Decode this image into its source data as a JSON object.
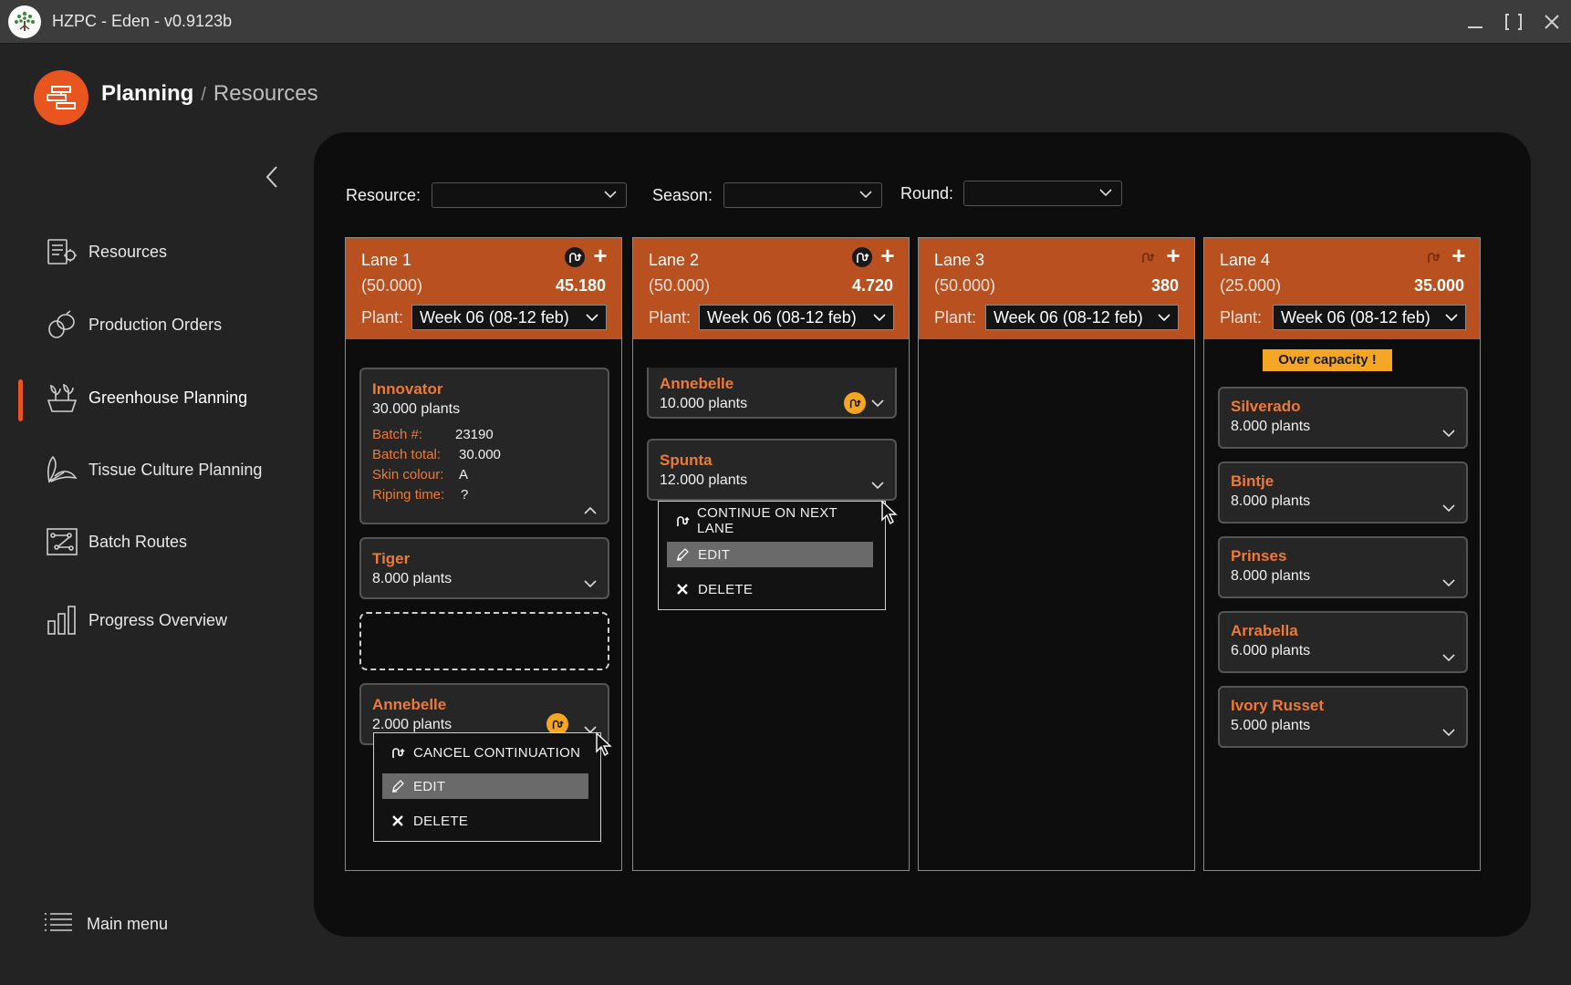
{
  "titlebar": {
    "title": "HZPC - Eden - v0.9123b",
    "icons": [
      "minimize-icon",
      "maximize-icon",
      "close-icon"
    ]
  },
  "header": {
    "current": "Planning",
    "separator": "/",
    "sub": "Resources"
  },
  "sidebar": {
    "items": [
      {
        "label": "Resources",
        "icon": "resources-icon"
      },
      {
        "label": "Production Orders",
        "icon": "production-orders-icon"
      },
      {
        "label": "Greenhouse Planning",
        "icon": "greenhouse-icon",
        "active": true
      },
      {
        "label": "Tissue Culture Planning",
        "icon": "leaf-icon"
      },
      {
        "label": "Batch Routes",
        "icon": "routes-icon"
      },
      {
        "label": "Progress Overview",
        "icon": "bar-chart-icon"
      }
    ],
    "main_menu": "Main menu"
  },
  "filters": {
    "resource": {
      "label": "Resource:",
      "value": ""
    },
    "season": {
      "label": "Season:",
      "value": ""
    },
    "round": {
      "label": "Round:",
      "value": ""
    }
  },
  "lanes": [
    {
      "name": "Lane 1",
      "capacity": "(50.000)",
      "total": "45.180",
      "plant_label": "Plant:",
      "week": "Week 06 (08-12 feb)",
      "cards": [
        {
          "name": "Innovator",
          "plants": "30.000 plants",
          "details": [
            {
              "label": "Batch #:",
              "value": "23190"
            },
            {
              "label": "Batch total:",
              "value": "30.000"
            },
            {
              "label": "Skin colour:",
              "value": "A"
            },
            {
              "label": "Riping time:",
              "value": "?"
            }
          ]
        },
        {
          "name": "Tiger",
          "plants": "8.000 plants"
        },
        {
          "name": "Annebelle",
          "plants": "2.000 plants"
        }
      ],
      "menu": [
        "CANCEL CONTINUATION",
        "EDIT",
        "DELETE"
      ]
    },
    {
      "name": "Lane 2",
      "capacity": "(50.000)",
      "total": "4.720",
      "plant_label": "Plant:",
      "week": "Week 06 (08-12 feb)",
      "cards": [
        {
          "name": "Annebelle",
          "plants": "10.000 plants"
        },
        {
          "name": "Spunta",
          "plants": "12.000 plants"
        }
      ],
      "menu": [
        "CONTINUE ON NEXT LANE",
        "EDIT",
        "DELETE"
      ]
    },
    {
      "name": "Lane 3",
      "capacity": "(50.000)",
      "total": "380",
      "plant_label": "Plant:",
      "week": "Week 06 (08-12 feb)",
      "cards": []
    },
    {
      "name": "Lane 4",
      "capacity": "(25.000)",
      "total": "35.000",
      "plant_label": "Plant:",
      "week": "Week 06 (08-12 feb)",
      "warning": "Over capacity !",
      "cards": [
        {
          "name": "Silverado",
          "plants": "8.000 plants"
        },
        {
          "name": "Bintje",
          "plants": "8.000 plants"
        },
        {
          "name": "Prinses",
          "plants": "8.000 plants"
        },
        {
          "name": "Arrabella",
          "plants": "6.000 plants"
        },
        {
          "name": "Ivory Russet",
          "plants": "5.000 plants"
        }
      ]
    }
  ],
  "colors": {
    "accent": "#e9541f",
    "lane_header": "#b8501f",
    "card_title": "#ee7a36",
    "badge": "#f5a623",
    "panel": "#0d0d0d"
  }
}
